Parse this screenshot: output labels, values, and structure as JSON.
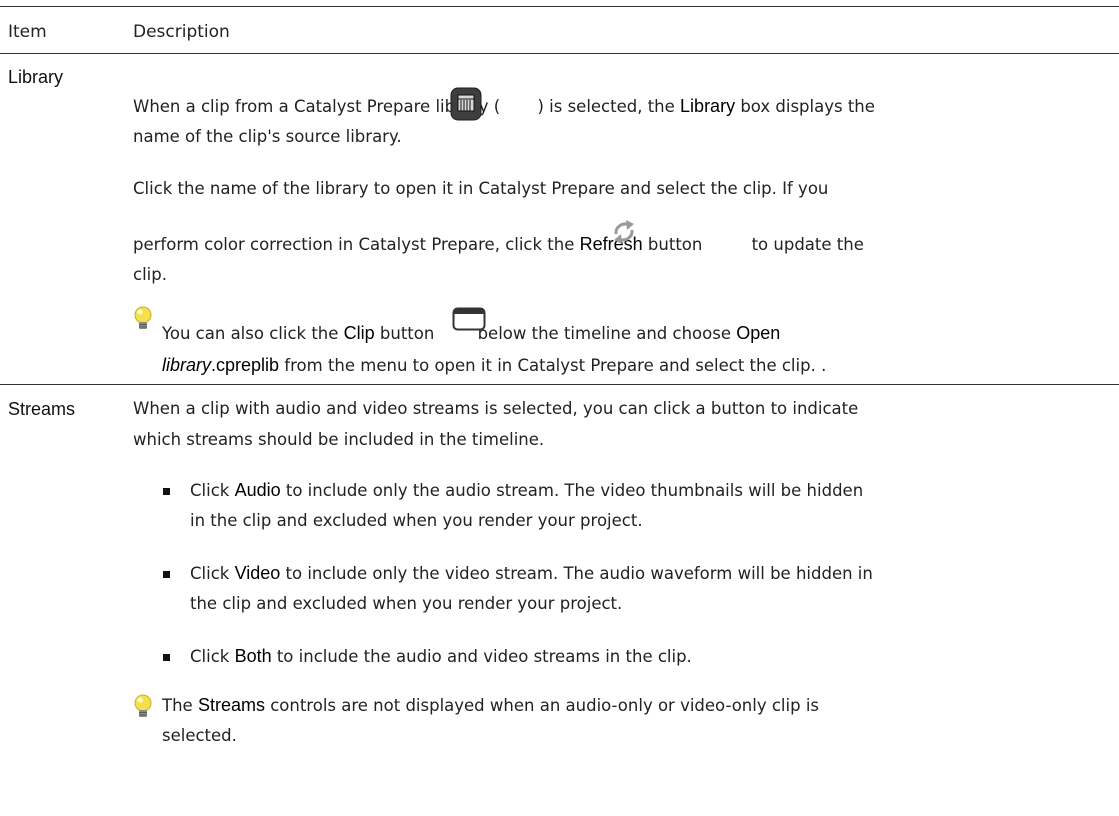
{
  "table": {
    "header": {
      "item": "Item",
      "description": "Description"
    },
    "library": {
      "name": "Library",
      "p1": {
        "a": "When a clip from a Catalyst Prepare library (",
        "b": ") is selected, the ",
        "kw": "Library",
        "c": " box displays the",
        "line2": "name of the clip's source library."
      },
      "p2": {
        "line1": "Click the name of the library to open it in Catalyst Prepare and select the clip. If you",
        "a": "perform color correction in Catalyst Prepare, click the ",
        "kw": "Refresh",
        "b": " button",
        "c": " to update the",
        "line3": "clip."
      },
      "tip": {
        "a": "You can also click the ",
        "kw_clip": "Clip",
        "b": " button",
        "c": " below the timeline and choose ",
        "kw_open": "Open",
        "kw_library": "library",
        "kw_ext": ".cpreplib",
        "d": " from the menu to open it in Catalyst Prepare and select the clip. ."
      }
    },
    "streams": {
      "name": "Streams",
      "intro": {
        "line1": "When a clip with audio and video streams is selected, you can click a button to indicate",
        "line2": "which streams should be included in the timeline."
      },
      "bullets": [
        {
          "pre": "Click ",
          "kw": "Audio",
          "post": " to include only the audio stream. The video thumbnails will be hidden",
          "line2": "in the clip and excluded when you render your project."
        },
        {
          "pre": "Click ",
          "kw": "Video",
          "post": " to include only the video stream. The audio waveform will be hidden in",
          "line2": "the clip and excluded when you render your project."
        },
        {
          "pre": "Click ",
          "kw": "Both",
          "post": " to include the audio and video streams in the clip."
        }
      ],
      "tip": {
        "a": "The ",
        "kw": "Streams",
        "b": " controls are not displayed when an audio-only or video-only clip is",
        "line2": "selected."
      }
    }
  },
  "icons": {
    "library": "library-icon",
    "refresh": "refresh-icon",
    "clip": "clip-button-icon",
    "tip": "lightbulb-icon"
  },
  "colors": {
    "rule": "#333333",
    "lightbulb": "#f3e04a",
    "refresh": "#9a9a9a"
  }
}
